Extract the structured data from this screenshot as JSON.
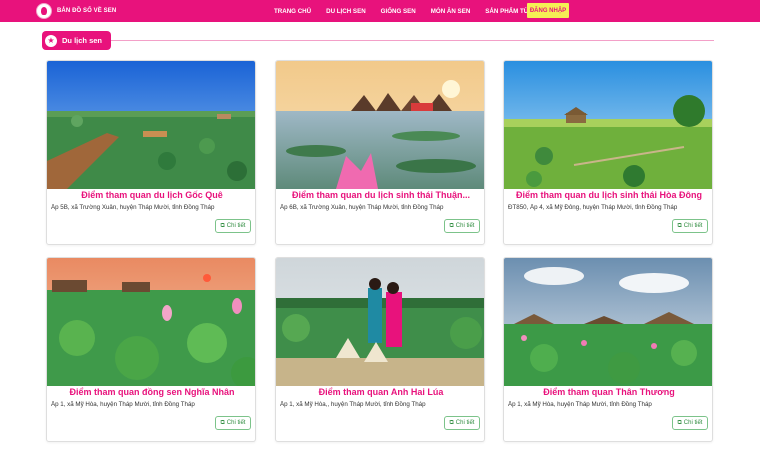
{
  "header": {
    "brand": "BẢN ĐỒ SỐ VỀ SEN",
    "nav": [
      "TRANG CHỦ",
      "DU LỊCH SEN",
      "GIỐNG SEN",
      "MÓN ĂN SEN",
      "SẢN PHẨM TỪ SEN"
    ],
    "login": "ĐĂNG NHẬP",
    "logo_icon": "lotus-logo-icon"
  },
  "section": {
    "title": "Du lịch sen",
    "icon": "star-icon"
  },
  "colors": {
    "accent": "#e8127c",
    "login_bg": "#f5ef55",
    "detail_border": "#7cc38a"
  },
  "cards": [
    {
      "title": "Điểm tham quan du lịch Gốc Quê",
      "address": "Ấp 5B, xã Trường Xuân, huyện Tháp Mười, tỉnh Đồng Tháp",
      "detail": "Chi tiết"
    },
    {
      "title": "Điểm tham quan du lịch sinh thái Thuận...",
      "address": "Ấp 6B, xã Trường Xuân, huyện Tháp Mười, tỉnh Đồng Tháp",
      "detail": "Chi tiết"
    },
    {
      "title": "Điểm tham quan du lịch sinh thái Hòa Đông",
      "address": "ĐT850, Ấp 4, xã Mỹ Đông, huyện Tháp Mười, tỉnh Đồng Tháp",
      "detail": "Chi tiết"
    },
    {
      "title": "Điểm tham quan đồng sen Nghĩa Nhân",
      "address": "Ấp 1, xã Mỹ Hòa, huyện Tháp Mười, tỉnh Đồng Tháp",
      "detail": "Chi tiết"
    },
    {
      "title": "Điểm tham quan Anh Hai Lúa",
      "address": "Ấp 1, xã Mỹ Hòa,, huyện Tháp Mười, tỉnh Đồng Tháp",
      "detail": "Chi tiết"
    },
    {
      "title": "Điểm tham quan Thân Thương",
      "address": "Ấp 1, xã Mỹ Hòa, huyện Tháp Mười, tỉnh Đồng Tháp",
      "detail": "Chi tiết"
    }
  ]
}
